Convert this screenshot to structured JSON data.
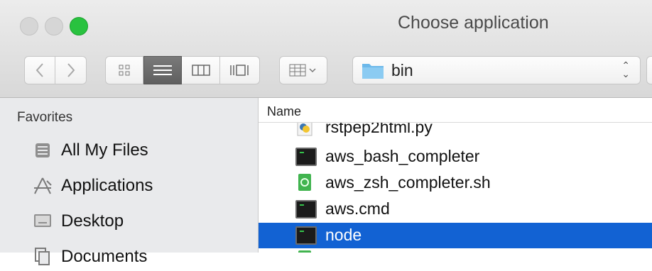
{
  "window": {
    "title": "Choose application"
  },
  "toolbar": {
    "back": "‹",
    "forward": "›",
    "path": {
      "label": "bin"
    }
  },
  "sidebar": {
    "heading": "Favorites",
    "items": [
      {
        "label": "All My Files",
        "icon": "all-files-icon"
      },
      {
        "label": "Applications",
        "icon": "applications-icon"
      },
      {
        "label": "Desktop",
        "icon": "desktop-icon"
      },
      {
        "label": "Documents",
        "icon": "documents-icon"
      }
    ]
  },
  "file_list": {
    "column_name": "Name",
    "rows": [
      {
        "name": "rstpep2html.py",
        "icon": "python-file-icon"
      },
      {
        "name": "aws_bash_completer",
        "icon": "terminal-icon"
      },
      {
        "name": "aws_zsh_completer.sh",
        "icon": "shell-script-icon"
      },
      {
        "name": "aws.cmd",
        "icon": "terminal-icon"
      },
      {
        "name": "node",
        "icon": "terminal-icon",
        "selected": true
      }
    ]
  },
  "colors": {
    "selection": "#1262d3",
    "close_active": "#29c23f"
  }
}
